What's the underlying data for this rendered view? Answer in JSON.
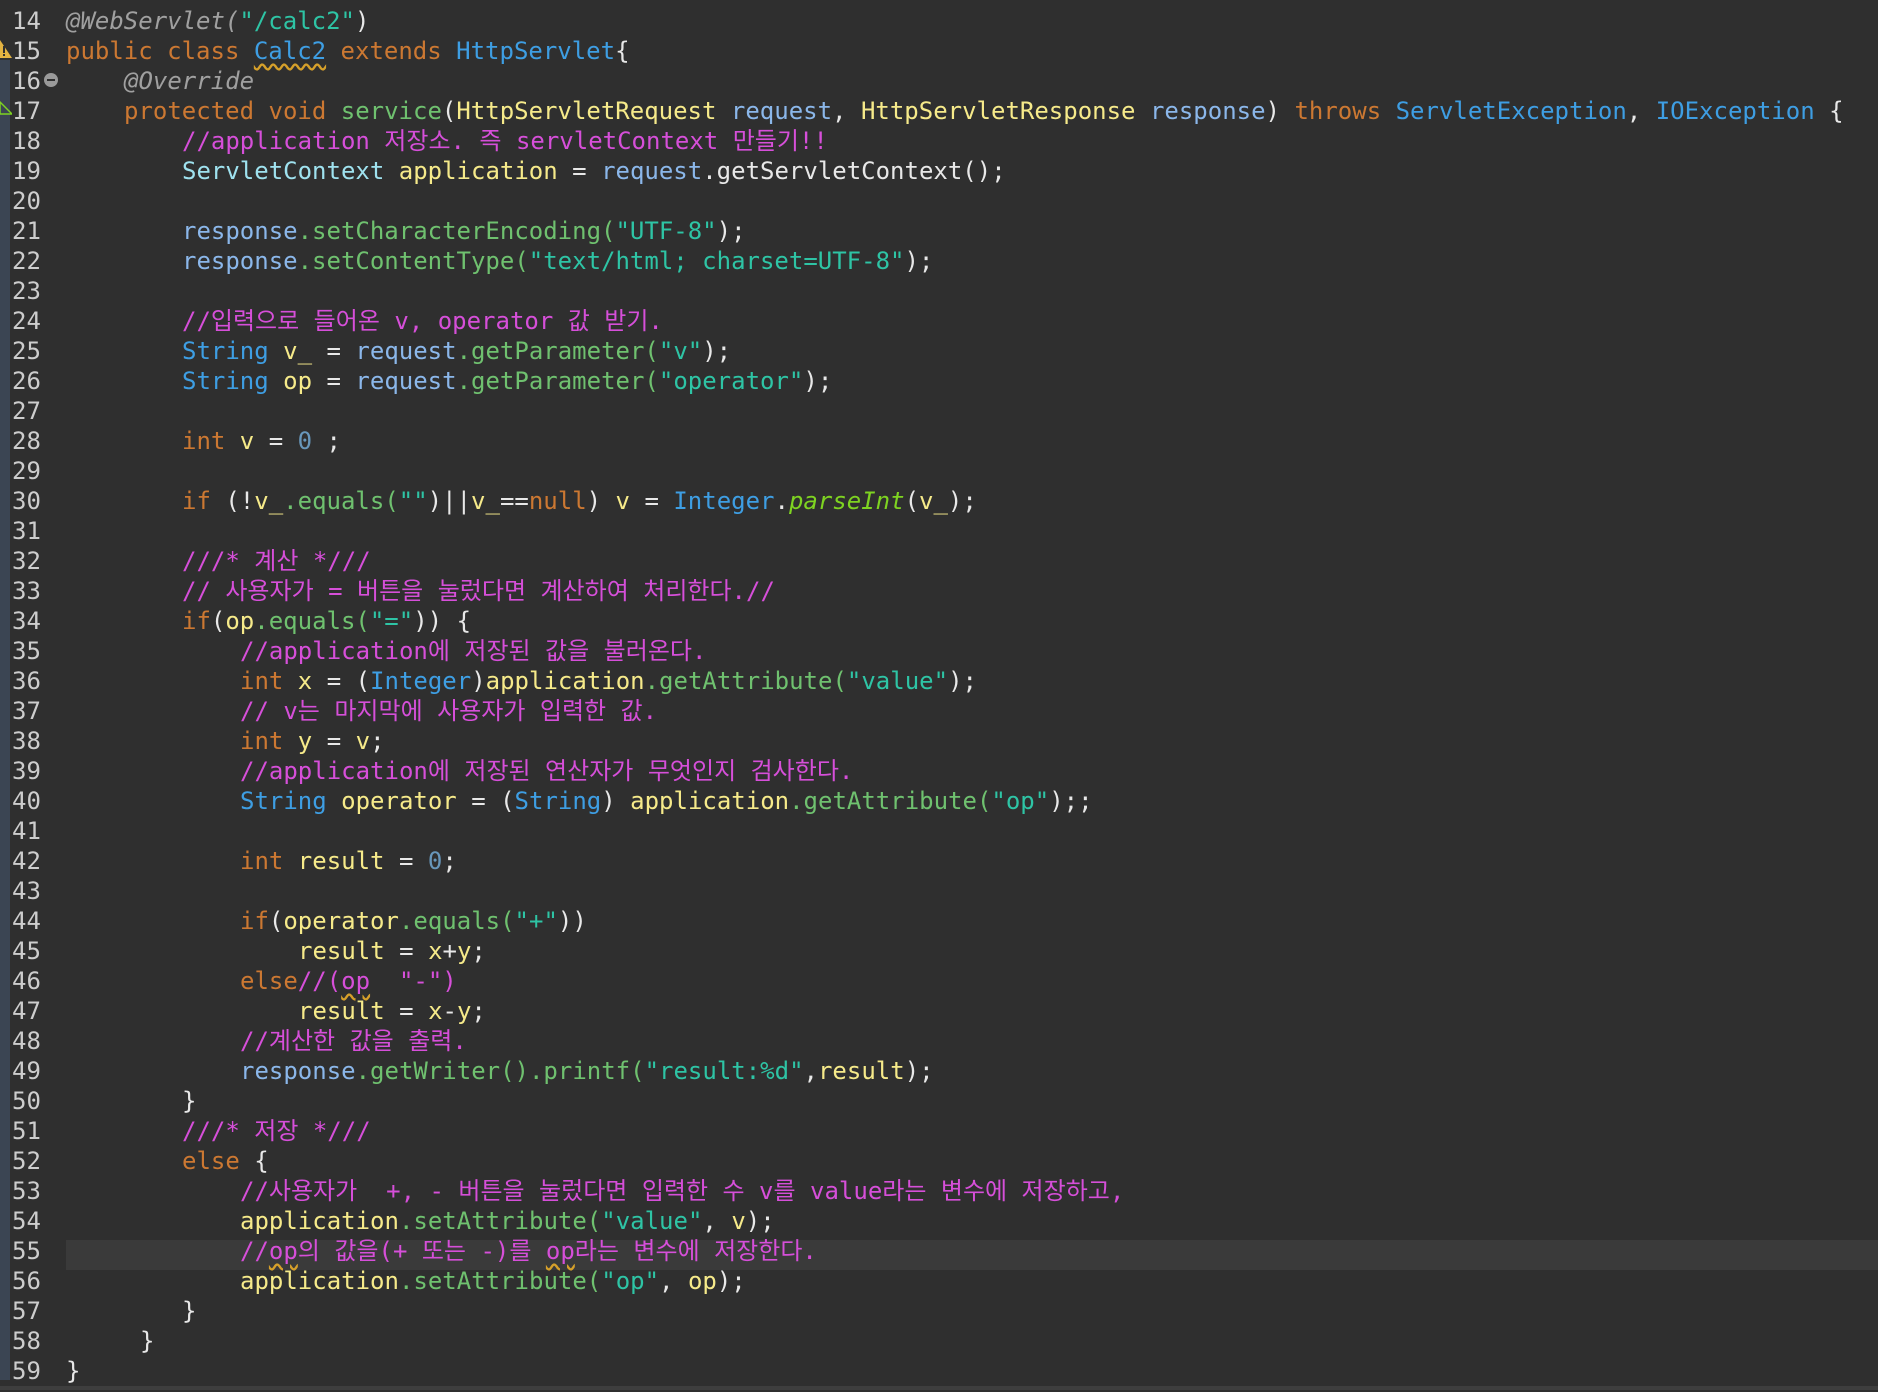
{
  "editor": {
    "line_numbers": [
      "14",
      "15",
      "16",
      "17",
      "18",
      "19",
      "20",
      "21",
      "22",
      "23",
      "24",
      "25",
      "26",
      "27",
      "28",
      "29",
      "30",
      "31",
      "32",
      "33",
      "34",
      "35",
      "36",
      "37",
      "38",
      "39",
      "40",
      "41",
      "42",
      "43",
      "44",
      "45",
      "46",
      "47",
      "48",
      "49",
      "50",
      "51",
      "52",
      "53",
      "54",
      "55",
      "56",
      "57",
      "58",
      "59"
    ],
    "code": {
      "l14": {
        "a": "@WebServlet(",
        "b": "\"/calc2\"",
        "c": ")"
      },
      "l15": {
        "a": "public class ",
        "b": "Calc2",
        "c": " extends ",
        "d": "HttpServlet",
        "e": "{"
      },
      "l16": {
        "a": "@Override"
      },
      "l17": {
        "a": "protected void ",
        "b": "service",
        "c": "(",
        "d": "HttpServletRequest",
        "e": " request",
        "f": ", ",
        "g": "HttpServletResponse",
        "h": " response",
        "i": ") ",
        "j": "throws ",
        "k": "ServletException",
        "l": ", ",
        "m": "IOException",
        "n": " {"
      },
      "l18": {
        "a": "//application 저장소. 즉 servletContext 만들기!!"
      },
      "l19": {
        "a": "ServletContext ",
        "b": "application",
        "c": " = ",
        "d": "request",
        "e": ".getServletContext();"
      },
      "l21": {
        "a": "response",
        "b": ".setCharacterEncoding(",
        "c": "\"UTF-8\"",
        "d": ");"
      },
      "l22": {
        "a": "response",
        "b": ".setContentType(",
        "c": "\"text/html; charset=UTF-8\"",
        "d": ");"
      },
      "l24": {
        "a": "//입력으로 들어온 v, operator 값 받기."
      },
      "l25": {
        "a": "String ",
        "b": "v_",
        "c": " = ",
        "d": "request",
        ".e": "",
        "e": ".getParameter(",
        "f": "\"v\"",
        "g": ");"
      },
      "l26": {
        "a": "String ",
        "b": "op",
        "c": " = ",
        "d": "request",
        "e": ".getParameter(",
        "f": "\"operator\"",
        "g": ");"
      },
      "l28": {
        "a": "int ",
        "b": "v",
        "c": " = ",
        "d": "0",
        "e": " ;"
      },
      "l30": {
        "a": "if ",
        "b": "(!",
        "c": "v_",
        ".d": "",
        "d": ".equals(",
        "e": "\"\"",
        "f": ")||",
        "g": "v_",
        "h": "==",
        "i": "null",
        "j": ") ",
        "k": "v",
        "l": " = ",
        "m": "Integer",
        "n": ".",
        "o": "parseInt",
        "p": "(",
        "q": "v_",
        "r": ");"
      },
      "l32": {
        "a": "///* 계산 *///"
      },
      "l33": {
        "a": "// 사용자가 = 버튼을 눌렀다면 계산하여 처리한다.//"
      },
      "l34": {
        "a": "if",
        "b": "(",
        "c": "op",
        "d": ".equals(",
        "e": "\"=\"",
        "f": ")) {"
      },
      "l35": {
        "a": "//application에 저장된 값을 불러온다."
      },
      "l36": {
        "a": "int ",
        "b": "x",
        "c": " = (",
        "d": "Integer",
        "e": ")",
        "f": "application",
        "g": ".getAttribute(",
        "h": "\"value\"",
        "i": ");"
      },
      "l37": {
        "a": "// v는 마지막에 사용자가 입력한 값."
      },
      "l38": {
        "a": "int ",
        "b": "y",
        "c": " = ",
        "d": "v",
        "e": ";"
      },
      "l39": {
        "a": "//application에 저장된 연산자가 무엇인지 검사한다."
      },
      "l40": {
        "a": "String ",
        "b": "operator",
        "c": " = (",
        "d": "String",
        "e": ") ",
        "f": "application",
        "g": ".getAttribute(",
        "h": "\"op\"",
        "i": ");;"
      },
      "l42": {
        "a": "int ",
        "b": "result",
        "c": " = ",
        "d": "0",
        "e": ";"
      },
      "l44": {
        "a": "if",
        "b": "(",
        "c": "operator",
        "d": ".equals(",
        "e": "\"+\"",
        "f": "))"
      },
      "l45": {
        "a": "result",
        "b": " = ",
        "c": "x",
        "d": "+",
        "e": "y",
        "f": ";"
      },
      "l46": {
        "a": "else",
        "b": "//(",
        "c": "op",
        "d": "  \"-\")"
      },
      "l47": {
        "a": "result",
        "b": " = ",
        "c": "x",
        "d": "-",
        "e": "y",
        "f": ";"
      },
      "l48": {
        "a": "//계산한 값을 출력."
      },
      "l49": {
        "a": "response",
        "b": ".getWriter().printf(",
        "c": "\"result:%d\"",
        "d": ",",
        "e": "result",
        "f": ");"
      },
      "l50": {
        "a": "}"
      },
      "l51": {
        "a": "///* 저장 *///"
      },
      "l52": {
        "a": "else ",
        "b": "{"
      },
      "l53": {
        "a": "//사용자가  +, - 버튼을 눌렀다면 입력한 수 v를 value라는 변수에 저장하고,"
      },
      "l54": {
        "a": "application",
        "b": ".setAttribute(",
        "c": "\"value\"",
        "d": ", ",
        "e": "v",
        "f": ");"
      },
      "l55": {
        "a": "//",
        "b": "op",
        "c": "의 값을(+ 또는 -)를 ",
        "d": "op",
        "e": "라는 변수에 저장한다."
      },
      "l56": {
        "a": "application",
        "b": ".setAttribute(",
        "c": "\"op\"",
        "d": ", ",
        "e": "op",
        "f": ");"
      },
      "l57": {
        "a": "}"
      },
      "l58": {
        "a": "}"
      },
      "l59": {
        "a": "}"
      }
    }
  },
  "colors": {
    "background": "#2f2f2f",
    "keyword": "#cc7832",
    "type": "#3e9ee3",
    "field": "#f6ea8a",
    "string": "#2ec4a5",
    "comment": "#d64fd9",
    "method": "#6fc16f"
  },
  "icons": [
    "warning-icon",
    "fold-collapse-icon",
    "override-marker-icon"
  ]
}
